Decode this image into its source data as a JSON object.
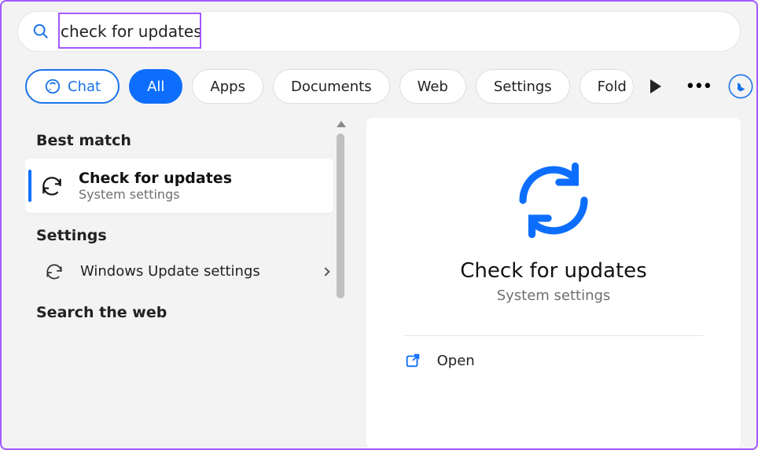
{
  "search": {
    "query": "check for updates"
  },
  "filters": {
    "chat": "Chat",
    "all": "All",
    "apps": "Apps",
    "documents": "Documents",
    "web": "Web",
    "settings": "Settings",
    "folders": "Fold"
  },
  "left": {
    "best_match_header": "Best match",
    "result": {
      "title": "Check for updates",
      "subtitle": "System settings"
    },
    "settings_header": "Settings",
    "settings_item": "Windows Update settings",
    "search_web_header": "Search the web"
  },
  "preview": {
    "title": "Check for updates",
    "subtitle": "System settings",
    "open_label": "Open"
  },
  "colors": {
    "accent": "#0d6efd",
    "highlight": "#a259ff"
  }
}
